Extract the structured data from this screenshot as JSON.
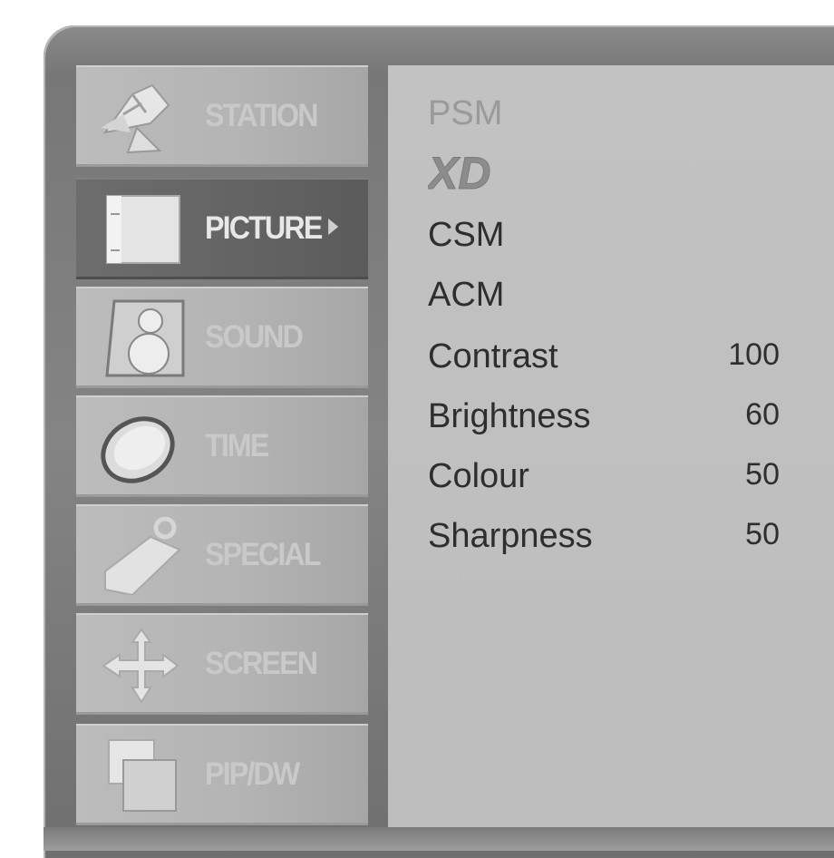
{
  "menu": {
    "items": [
      {
        "label": "STATION",
        "icon": "satellite-dish-icon",
        "active": false
      },
      {
        "label": "PICTURE",
        "icon": "picture-icon",
        "active": true
      },
      {
        "label": "SOUND",
        "icon": "speaker-icon",
        "active": false
      },
      {
        "label": "TIME",
        "icon": "clock-icon",
        "active": false
      },
      {
        "label": "SPECIAL",
        "icon": "tag-icon",
        "active": false
      },
      {
        "label": "SCREEN",
        "icon": "move-arrows-icon",
        "active": false
      },
      {
        "label": "PIP/DW",
        "icon": "pip-windows-icon",
        "active": false
      }
    ]
  },
  "picture_menu": {
    "items": [
      {
        "label": "PSM",
        "dim": true
      },
      {
        "label": "XD",
        "logo": true
      },
      {
        "label": "CSM"
      },
      {
        "label": "ACM"
      },
      {
        "label": "Contrast",
        "value": "100"
      },
      {
        "label": "Brightness",
        "value": "60"
      },
      {
        "label": "Colour",
        "value": "50"
      },
      {
        "label": "Sharpness",
        "value": "50"
      }
    ]
  },
  "colors": {
    "frame": "#7d7d7d",
    "panel": "#c0c0c0",
    "active_item": "#666666",
    "text": "#2e2e2e"
  }
}
